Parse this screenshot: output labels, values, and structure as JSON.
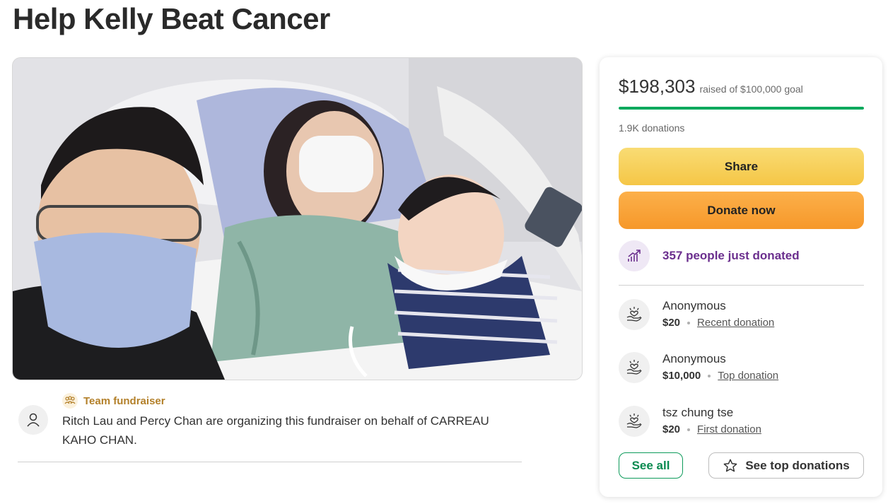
{
  "page": {
    "title": "Help Kelly Beat Cancer"
  },
  "organizer": {
    "badge_label": "Team fundraiser",
    "description": "Ritch Lau and Percy Chan are organizing this fundraiser on behalf of CARREAU KAHO CHAN."
  },
  "donate_card": {
    "raised_amount": "$198,303",
    "raised_goal_text": "raised of $100,000 goal",
    "progress_fraction": 1.0,
    "donation_count": "1.9K donations",
    "share_label": "Share",
    "donate_label": "Donate now",
    "momentum_text": "357 people just donated",
    "donations": [
      {
        "name": "Anonymous",
        "amount": "$20",
        "tag": "Recent donation"
      },
      {
        "name": "Anonymous",
        "amount": "$10,000",
        "tag": "Top donation"
      },
      {
        "name": "tsz chung tse",
        "amount": "$20",
        "tag": "First donation"
      }
    ],
    "see_all_label": "See all",
    "see_top_label": "See top donations"
  },
  "colors": {
    "progress_green": "#02a95c",
    "share_yellow": "#f7cf56",
    "donate_orange": "#f9a239",
    "momentum_purple": "#6b2f8e",
    "team_gold": "#b3802a"
  },
  "icons": {
    "team": "people-group-icon",
    "avatar": "user-icon",
    "momentum": "trending-up-icon",
    "donation": "hand-heart-icon",
    "star": "star-icon"
  }
}
